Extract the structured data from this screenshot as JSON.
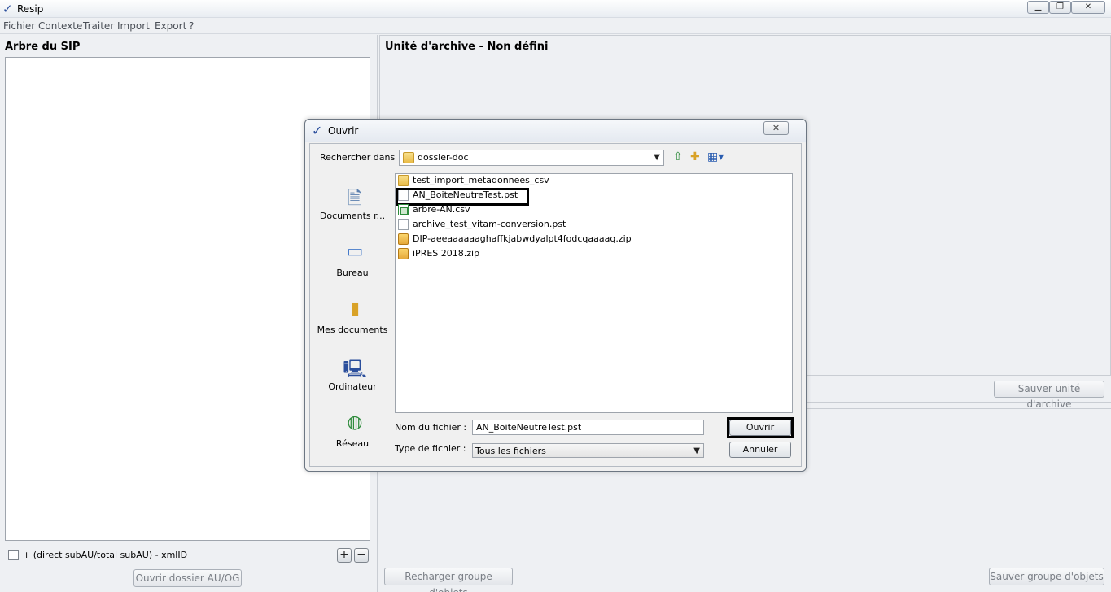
{
  "window": {
    "title": "Resip"
  },
  "menu": [
    "Fichier",
    "Contexte",
    "Traiter",
    "Import",
    "Export",
    "?"
  ],
  "left_panel": {
    "title": "Arbre du SIP",
    "checkbox_label": "+ (direct subAU/total subAU) - xmlID",
    "add_button": "+",
    "remove_button": "−",
    "open_button": "Ouvrir dossier AU/OG"
  },
  "right_panel": {
    "title": "Unité d'archive - Non défini",
    "save_unit_button": "Sauver unité d'archive",
    "reload_button": "Recharger groupe d'objets",
    "save_group_button": "Sauver groupe d'objets"
  },
  "dialog": {
    "title": "Ouvrir",
    "close_glyph": "✕",
    "look_in_label": "Rechercher dans :",
    "look_in_value": "dossier-doc",
    "places": [
      {
        "label": "Documents r...",
        "icon": "recent-documents-icon"
      },
      {
        "label": "Bureau",
        "icon": "desktop-icon"
      },
      {
        "label": "Mes documents",
        "icon": "my-documents-icon"
      },
      {
        "label": "Ordinateur",
        "icon": "computer-icon"
      },
      {
        "label": "Réseau",
        "icon": "network-icon"
      }
    ],
    "files": [
      {
        "name": "test_import_metadonnees_csv",
        "type": "folder"
      },
      {
        "name": "AN_BoiteNeutreTest.pst",
        "type": "doc",
        "selected": true
      },
      {
        "name": "arbre-AN.csv",
        "type": "csv"
      },
      {
        "name": "archive_test_vitam-conversion.pst",
        "type": "doc"
      },
      {
        "name": "DIP-aeeaaaaaaghaffkjabwdyalpt4fodcqaaaaq.zip",
        "type": "zip"
      },
      {
        "name": "iPRES 2018.zip",
        "type": "zip"
      }
    ],
    "filename_label": "Nom du fichier :",
    "filename_value": "AN_BoiteNeutreTest.pst",
    "filetype_label": "Type de fichier :",
    "filetype_value": "Tous les fichiers",
    "open_button": "Ouvrir",
    "cancel_button": "Annuler"
  }
}
